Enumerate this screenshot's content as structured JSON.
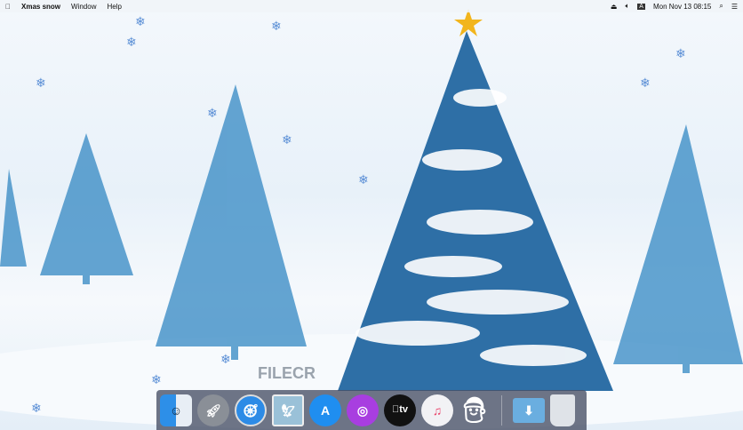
{
  "menubar": {
    "app_name": "Xmas snow",
    "menus": [
      "Window",
      "Help"
    ],
    "datetime": "Mon Nov 13  08:15",
    "input_source": "A"
  },
  "dock": {
    "apps": [
      "Finder",
      "Launchpad",
      "Safari",
      "Preview",
      "App Store",
      "Podcasts",
      "Apple TV",
      "Music",
      "Xmas snow",
      "Downloads",
      "Trash"
    ],
    "tv_label": "tv"
  },
  "watermark": {
    "text": "FILECR"
  }
}
